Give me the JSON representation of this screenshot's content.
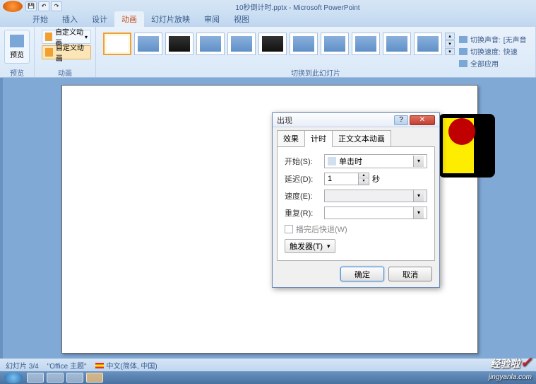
{
  "app": {
    "title": "10秒倒计时.pptx - Microsoft PowerPoint"
  },
  "tabs": {
    "home": "开始",
    "insert": "插入",
    "design": "设计",
    "animation": "动画",
    "slideshow": "幻灯片放映",
    "review": "审阅",
    "view": "视图"
  },
  "ribbon": {
    "preview": "预览",
    "preview_group": "预览",
    "anim_dropdown": "自定义动画",
    "custom_anim": "自定义动画",
    "anim_group": "动画",
    "transition_group": "切换到此幻灯片",
    "sound_label": "切换声音:",
    "sound_value": "[无声音",
    "speed_label": "切换速度:",
    "speed_value": "快速",
    "apply_all": "全部应用"
  },
  "dialog": {
    "title": "出现",
    "tab_effect": "效果",
    "tab_timing": "计时",
    "tab_text": "正文文本动画",
    "start_label": "开始(S):",
    "start_value": "单击时",
    "delay_label": "延迟(D):",
    "delay_value": "1",
    "delay_unit": "秒",
    "speed_label": "速度(E):",
    "repeat_label": "重复(R):",
    "rewind_label": "播完后快退(W)",
    "trigger_label": "触发器(T)",
    "ok": "确定",
    "cancel": "取消"
  },
  "status": {
    "slide_info": "幻灯片 3/4",
    "theme": "\"Office 主题\"",
    "language": "中文(简体, 中国)"
  },
  "watermark": {
    "main": "经验啦",
    "sub": "jingyanla.com"
  }
}
